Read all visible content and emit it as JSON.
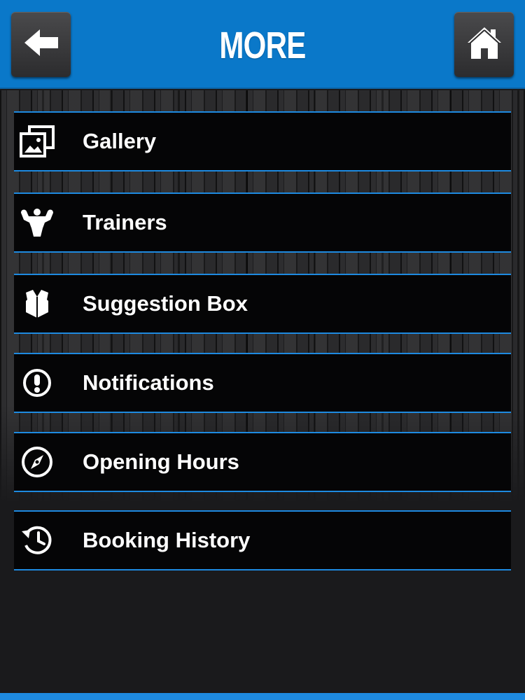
{
  "header": {
    "title": "MORE",
    "back_icon": "arrow-left-icon",
    "home_icon": "home-icon",
    "accent_color": "#0a78c9"
  },
  "menu": {
    "items": [
      {
        "label": "Gallery",
        "icon": "gallery-icon"
      },
      {
        "label": "Trainers",
        "icon": "bodybuilder-icon"
      },
      {
        "label": "Suggestion Box",
        "icon": "box-icon"
      },
      {
        "label": "Notifications",
        "icon": "exclamation-circle-icon"
      },
      {
        "label": "Opening Hours",
        "icon": "compass-icon"
      },
      {
        "label": "Booking History",
        "icon": "history-icon"
      }
    ],
    "border_color": "#1e8ae0"
  }
}
